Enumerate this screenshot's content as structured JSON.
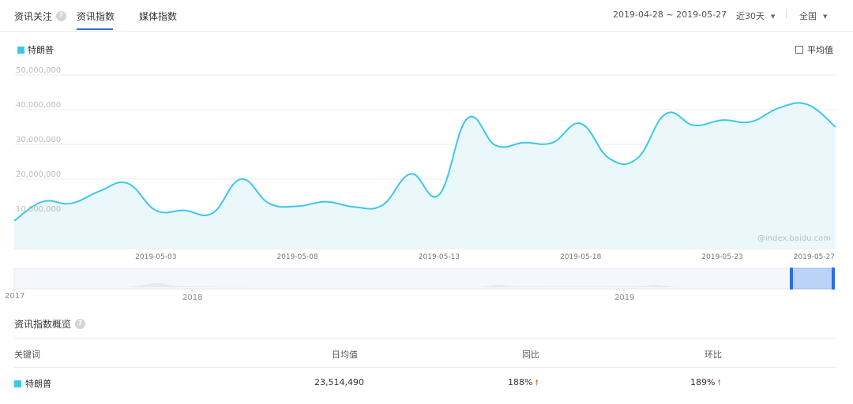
{
  "header": {
    "brand": "资讯关注",
    "tabs": [
      {
        "label": "资讯指数",
        "active": true
      },
      {
        "label": "媒体指数",
        "active": false
      }
    ],
    "date_range": "2019-04-28 ~ 2019-05-27",
    "period": "近30天",
    "region": "全国"
  },
  "legend": {
    "label": "特朗普",
    "color": "#3ec7ec"
  },
  "avg_toggle": {
    "label": "平均值",
    "checked": false
  },
  "watermark": "@index.baidu.com",
  "chart_data": {
    "type": "area",
    "title": "",
    "xlabel": "",
    "ylabel": "",
    "ylim": [
      0,
      50000000
    ],
    "yticks": [
      {
        "value": 10000000,
        "label": "10,000,000"
      },
      {
        "value": 20000000,
        "label": "20,000,000"
      },
      {
        "value": 30000000,
        "label": "30,000,000"
      },
      {
        "value": 40000000,
        "label": "40,000,000"
      },
      {
        "value": 50000000,
        "label": "50,000,000"
      }
    ],
    "xticks": [
      "2019-05-03",
      "2019-05-08",
      "2019-05-13",
      "2019-05-18",
      "2019-05-23",
      "2019-05-27"
    ],
    "grid": true,
    "series": [
      {
        "name": "特朗普",
        "color": "#3ec7ec",
        "x": [
          "2019-04-28",
          "2019-04-29",
          "2019-04-30",
          "2019-05-01",
          "2019-05-02",
          "2019-05-03",
          "2019-05-04",
          "2019-05-05",
          "2019-05-06",
          "2019-05-07",
          "2019-05-08",
          "2019-05-09",
          "2019-05-10",
          "2019-05-11",
          "2019-05-12",
          "2019-05-13",
          "2019-05-14",
          "2019-05-15",
          "2019-05-16",
          "2019-05-17",
          "2019-05-18",
          "2019-05-19",
          "2019-05-20",
          "2019-05-21",
          "2019-05-22",
          "2019-05-23",
          "2019-05-24",
          "2019-05-25",
          "2019-05-26",
          "2019-05-27"
        ],
        "values": [
          8000000,
          13500000,
          13000000,
          16500000,
          18800000,
          11000000,
          11000000,
          10200000,
          20000000,
          13000000,
          12200000,
          13500000,
          12000000,
          12500000,
          21500000,
          15500000,
          37500000,
          29700000,
          30500000,
          30500000,
          36000000,
          26000000,
          26000000,
          38800000,
          35500000,
          37000000,
          36500000,
          40500000,
          41500000,
          35000000
        ]
      }
    ]
  },
  "navigator": {
    "year_labels": [
      "2017",
      "2018",
      "2019"
    ]
  },
  "overview": {
    "title": "资讯指数概览",
    "columns": [
      "关键词",
      "日均值",
      "同比",
      "环比"
    ],
    "rows": [
      {
        "keyword": "特朗普",
        "daily_avg": "23,514,490",
        "yoy": "188%",
        "mom": "189%"
      }
    ]
  }
}
